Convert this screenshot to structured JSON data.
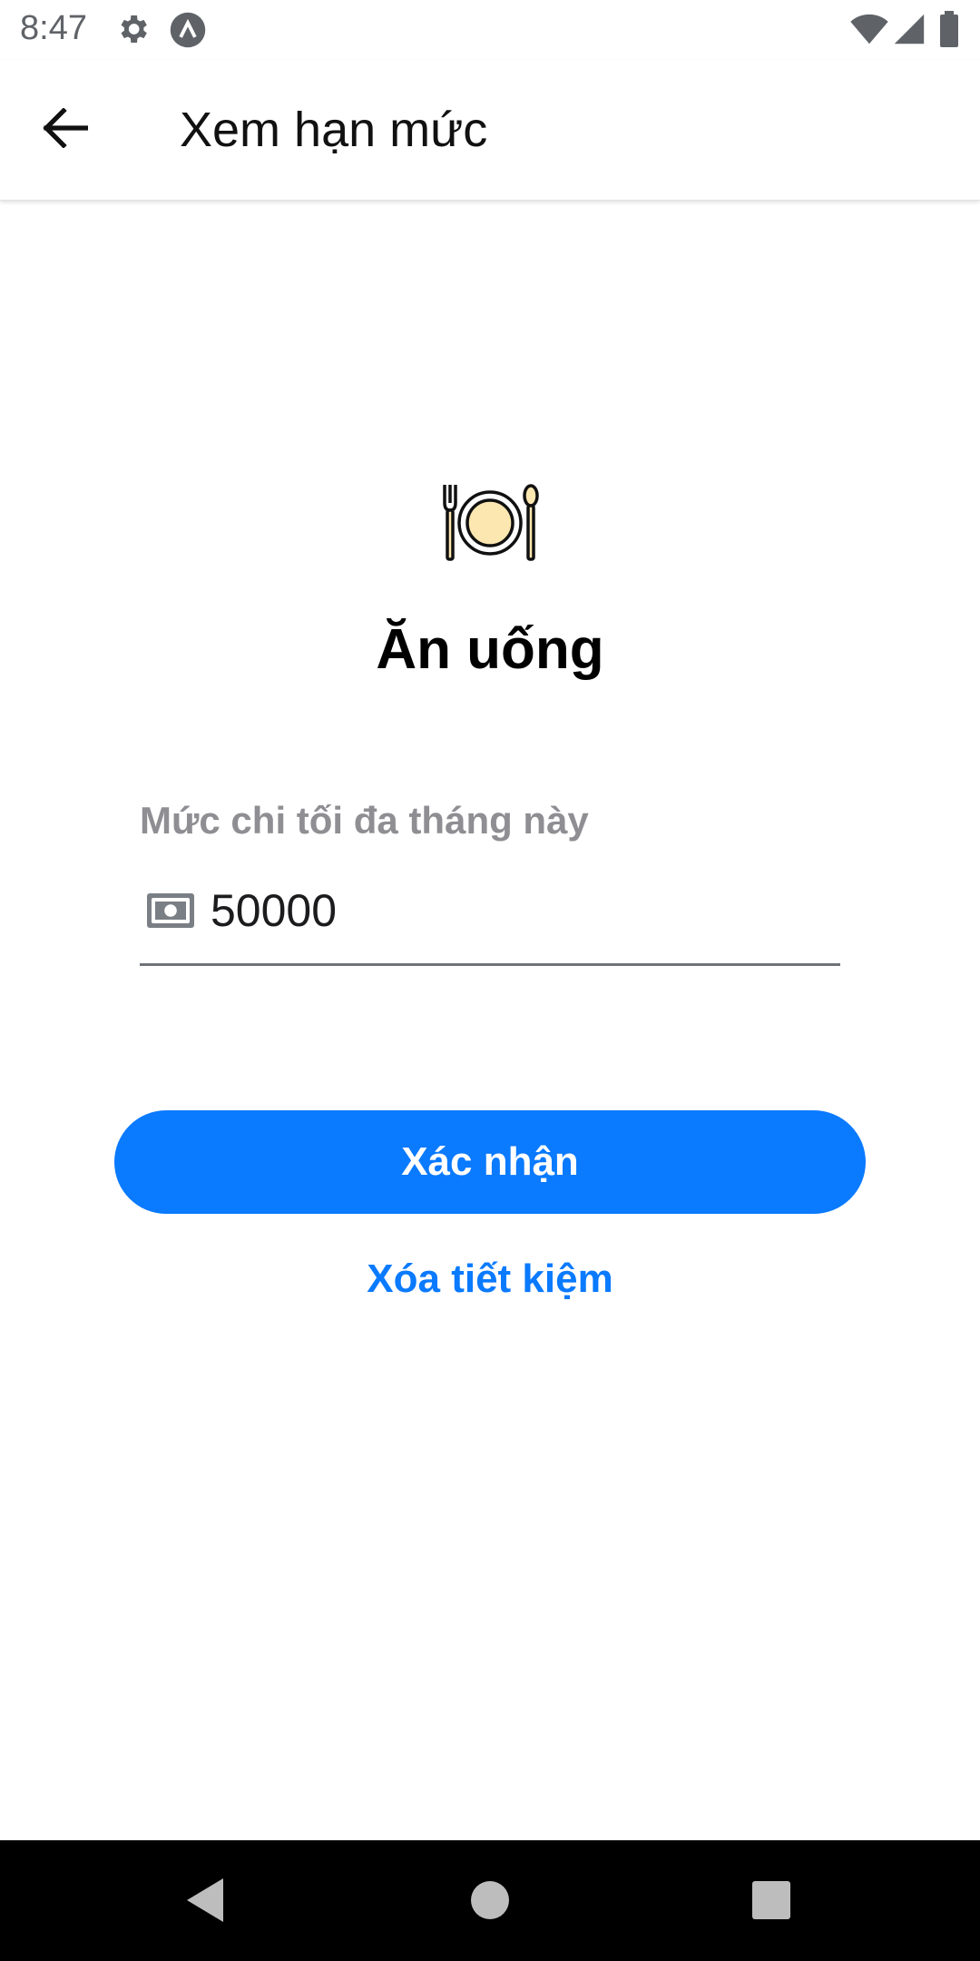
{
  "status_bar": {
    "time": "8:47",
    "icons": [
      "settings-icon",
      "app-notification-icon",
      "wifi-icon",
      "cell-signal-icon",
      "battery-icon"
    ]
  },
  "app_bar": {
    "back_icon": "arrow-left-icon",
    "title": "Xem hạn mức"
  },
  "category": {
    "icon": "plate-fork-spoon-icon",
    "name": "Ăn uống"
  },
  "limit_field": {
    "label": "Mức chi tối đa tháng này",
    "icon": "money-bill-icon",
    "value": "50000"
  },
  "actions": {
    "confirm_label": "Xác nhận",
    "delete_label": "Xóa tiết kiệm"
  },
  "nav_bar": {
    "buttons": [
      "back-triangle-icon",
      "home-circle-icon",
      "recents-square-icon"
    ]
  },
  "colors": {
    "accent": "#0a7aff",
    "label_gray": "#8e8e93",
    "plate_fill": "#fde7b0"
  }
}
